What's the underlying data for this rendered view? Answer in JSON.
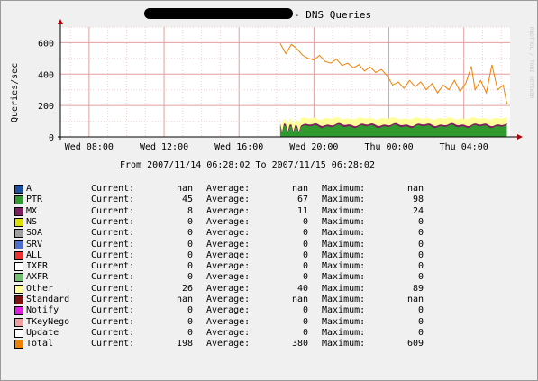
{
  "chart_data": {
    "type": "area",
    "title_prefix_redacted": true,
    "title": " - DNS Queries",
    "ylabel": "Queries/sec",
    "xlabel": "From 2007/11/14 06:28:02 To 2007/11/15 06:28:02",
    "watermark": "RRDTOOL / TOBI OETIKER",
    "ylim": [
      0,
      700
    ],
    "yticks": [
      0,
      200,
      400,
      600
    ],
    "x_range_hours": [
      6.467,
      30.467
    ],
    "xticks": [
      {
        "hour": 8,
        "label": "Wed 08:00"
      },
      {
        "hour": 12,
        "label": "Wed 12:00"
      },
      {
        "hour": 16,
        "label": "Wed 16:00"
      },
      {
        "hour": 20,
        "label": "Wed 20:00"
      },
      {
        "hour": 24,
        "label": "Thu 00:00"
      },
      {
        "hour": 28,
        "label": "Thu 04:00"
      }
    ],
    "data_start_hour": 18.2,
    "series": [
      {
        "name": "PTR",
        "color": "#2f9b2f",
        "approx_level": 67
      },
      {
        "name": "MX",
        "color": "#7f1f5f",
        "approx_level": 11
      },
      {
        "name": "Other",
        "color": "#ffff99",
        "approx_level": 40
      },
      {
        "name": "Total",
        "color": "#f08000",
        "points": [
          [
            18.2,
            595
          ],
          [
            18.5,
            530
          ],
          [
            18.8,
            590
          ],
          [
            19.1,
            560
          ],
          [
            19.4,
            520
          ],
          [
            19.7,
            500
          ],
          [
            20.0,
            490
          ],
          [
            20.3,
            520
          ],
          [
            20.6,
            480
          ],
          [
            20.9,
            470
          ],
          [
            21.2,
            495
          ],
          [
            21.5,
            455
          ],
          [
            21.8,
            470
          ],
          [
            22.1,
            440
          ],
          [
            22.4,
            460
          ],
          [
            22.7,
            420
          ],
          [
            23.0,
            445
          ],
          [
            23.3,
            410
          ],
          [
            23.6,
            430
          ],
          [
            23.9,
            390
          ],
          [
            24.2,
            330
          ],
          [
            24.5,
            350
          ],
          [
            24.8,
            310
          ],
          [
            25.1,
            360
          ],
          [
            25.4,
            320
          ],
          [
            25.7,
            350
          ],
          [
            26.0,
            300
          ],
          [
            26.3,
            340
          ],
          [
            26.6,
            280
          ],
          [
            26.9,
            330
          ],
          [
            27.2,
            300
          ],
          [
            27.5,
            360
          ],
          [
            27.8,
            290
          ],
          [
            28.1,
            340
          ],
          [
            28.4,
            450
          ],
          [
            28.6,
            300
          ],
          [
            28.9,
            360
          ],
          [
            29.2,
            280
          ],
          [
            29.5,
            460
          ],
          [
            29.8,
            300
          ],
          [
            30.1,
            330
          ],
          [
            30.3,
            210
          ]
        ]
      }
    ]
  },
  "legend": {
    "current_label": "Current:",
    "average_label": "Average:",
    "maximum_label": "Maximum:",
    "rows": [
      {
        "name": "A",
        "color": "#1f4fa0",
        "current": "nan",
        "average": "nan",
        "maximum": "nan"
      },
      {
        "name": "PTR",
        "color": "#2f9b2f",
        "current": "45",
        "average": "67",
        "maximum": "98"
      },
      {
        "name": "MX",
        "color": "#7f1f5f",
        "current": "8",
        "average": "11",
        "maximum": "24"
      },
      {
        "name": "NS",
        "color": "#e0e000",
        "current": "0",
        "average": "0",
        "maximum": "0"
      },
      {
        "name": "SOA",
        "color": "#9f9f9f",
        "current": "0",
        "average": "0",
        "maximum": "0"
      },
      {
        "name": "SRV",
        "color": "#4f6fcf",
        "current": "0",
        "average": "0",
        "maximum": "0"
      },
      {
        "name": "ALL",
        "color": "#f03030",
        "current": "0",
        "average": "0",
        "maximum": "0"
      },
      {
        "name": "IXFR",
        "color": "#ffffff",
        "current": "0",
        "average": "0",
        "maximum": "0"
      },
      {
        "name": "AXFR",
        "color": "#70c070",
        "current": "0",
        "average": "0",
        "maximum": "0"
      },
      {
        "name": "Other",
        "color": "#ffff99",
        "current": "26",
        "average": "40",
        "maximum": "89"
      },
      {
        "name": "Standard",
        "color": "#7f1010",
        "current": "nan",
        "average": "nan",
        "maximum": "nan"
      },
      {
        "name": "Notify",
        "color": "#e020e0",
        "current": "0",
        "average": "0",
        "maximum": "0"
      },
      {
        "name": "TKeyNego",
        "color": "#f0a0a0",
        "current": "0",
        "average": "0",
        "maximum": "0"
      },
      {
        "name": "Update",
        "color": "#ffffff",
        "current": "0",
        "average": "0",
        "maximum": "0"
      },
      {
        "name": "Total",
        "color": "#f08000",
        "current": "198",
        "average": "380",
        "maximum": "609"
      }
    ]
  }
}
